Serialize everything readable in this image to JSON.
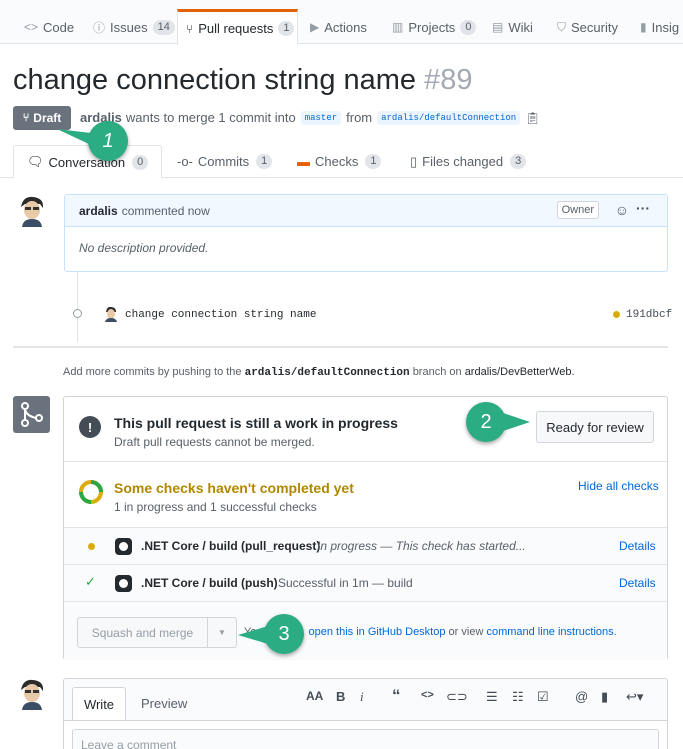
{
  "repo_tabs": [
    {
      "label": "Code",
      "icon": "code-icon"
    },
    {
      "label": "Issues",
      "count": "14",
      "icon": "issue-icon"
    },
    {
      "label": "Pull requests",
      "count": "1",
      "icon": "pull-request-icon"
    },
    {
      "label": "Actions",
      "icon": "play-icon"
    },
    {
      "label": "Projects",
      "count": "0",
      "icon": "project-icon"
    },
    {
      "label": "Wiki",
      "icon": "book-icon"
    },
    {
      "label": "Security",
      "icon": "shield-icon"
    },
    {
      "label": "Insig",
      "icon": "graph-icon"
    }
  ],
  "pr": {
    "title": "change connection string name",
    "number": "#89",
    "state": "Draft",
    "author": "ardalis",
    "merge_text": "wants to merge 1 commit into",
    "base_branch": "master",
    "from_text": "from",
    "head_branch": "ardalis/defaultConnection"
  },
  "pr_tabs": [
    {
      "label": "Conversation",
      "count": "0"
    },
    {
      "label": "Commits",
      "count": "1"
    },
    {
      "label": "Checks",
      "count": "1"
    },
    {
      "label": "Files changed",
      "count": "3"
    }
  ],
  "comment": {
    "author": "ardalis",
    "action": "commented now",
    "role": "Owner",
    "body": "No description provided."
  },
  "commit": {
    "message": "change connection string name",
    "sha": "191dbcf"
  },
  "hint": {
    "prefix": "Add more commits by pushing to the",
    "branch": "ardalis/defaultConnection",
    "middle": "branch on",
    "repo": "ardalis/DevBetterWeb."
  },
  "merge": {
    "wip_title": "This pull request is still a work in progress",
    "wip_sub": "Draft pull requests cannot be merged.",
    "ready_button": "Ready for review",
    "checks_title": "Some checks haven't completed yet",
    "checks_sub": "1 in progress and 1 successful checks",
    "hide_checks": "Hide all checks",
    "checks": [
      {
        "name": ".NET Core / build (pull_request)",
        "status": "In progress — This check has started...",
        "details": "Details",
        "state": "pending"
      },
      {
        "name": ".NET Core / build (push)",
        "status": "Successful in 1m — build",
        "details": "Details",
        "state": "success"
      }
    ],
    "squash_button": "Squash and merge",
    "footer_prefix": "Yo",
    "footer_link1": "open this in GitHub Desktop",
    "footer_mid": "or view",
    "footer_link2": "command line instructions",
    "footer_end": "."
  },
  "callouts": [
    "1",
    "2",
    "3"
  ],
  "editor": {
    "tab_write": "Write",
    "tab_preview": "Preview",
    "placeholder": "Leave a comment",
    "toolbar": [
      "AA",
      "B",
      "i",
      "“",
      "<>",
      "link",
      "ul",
      "ol",
      "tasks",
      "@",
      "bookmark",
      "reply"
    ]
  },
  "colors": {
    "accent_tab": "#e36209",
    "link": "#0366d6",
    "draft": "#6a737d",
    "pending": "#dbab09",
    "success": "#28a745",
    "callout": "#2bac82"
  }
}
